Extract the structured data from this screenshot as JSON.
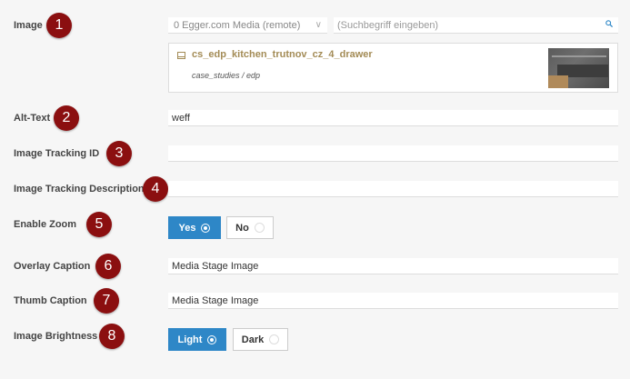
{
  "image": {
    "label": "Image",
    "marker": "1",
    "source_select": "0 Egger.com Media (remote)",
    "search_placeholder": "(Suchbegriff eingeben)",
    "media_title": "cs_edp_kitchen_trutnov_cz_4_drawer",
    "media_path": "case_studies / edp"
  },
  "alt_text": {
    "label": "Alt-Text",
    "marker": "2",
    "value": "weff"
  },
  "tracking_id": {
    "label": "Image Tracking ID",
    "marker": "3",
    "value": ""
  },
  "tracking_description": {
    "label": "Image Tracking Description",
    "marker": "4",
    "value": ""
  },
  "enable_zoom": {
    "label": "Enable Zoom",
    "marker": "5",
    "yes_label": "Yes",
    "no_label": "No",
    "selected": "Yes"
  },
  "overlay_caption": {
    "label": "Overlay Caption",
    "marker": "6",
    "value": "Media Stage Image"
  },
  "thumb_caption": {
    "label": "Thumb Caption",
    "marker": "7",
    "value": "Media Stage Image"
  },
  "brightness": {
    "label": "Image Brightness",
    "marker": "8",
    "light_label": "Light",
    "dark_label": "Dark",
    "selected": "Light"
  },
  "colors": {
    "marker_bg": "#8b0f10",
    "accent_blue": "#2e87c7",
    "media_title": "#a38b55"
  }
}
